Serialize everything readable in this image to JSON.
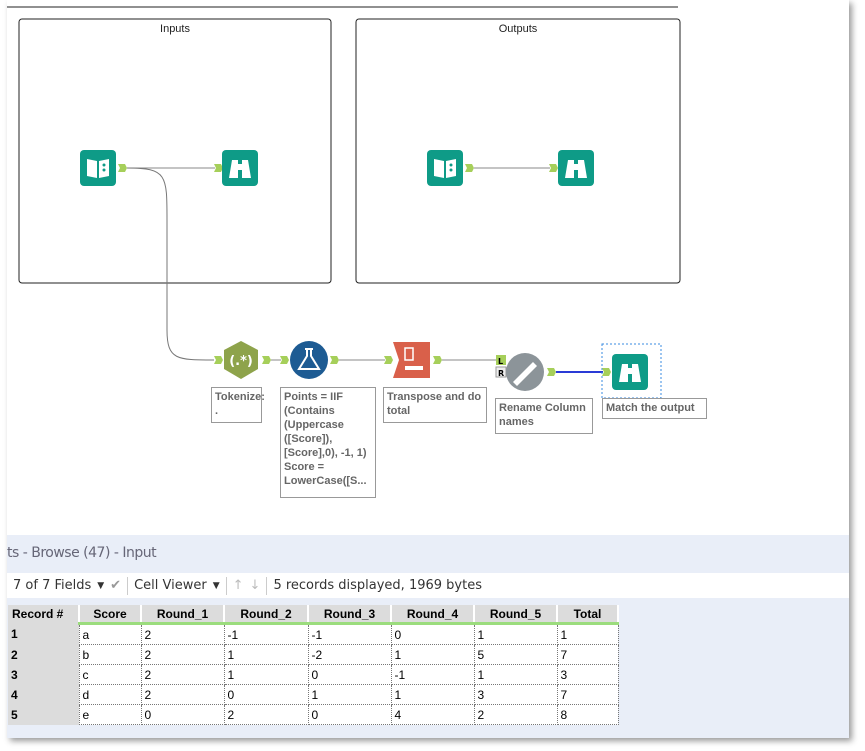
{
  "containers": [
    {
      "title": "Inputs"
    },
    {
      "title": "Outputs"
    }
  ],
  "tools": [
    {
      "name": "Tokenize",
      "annotation": "Tokenize:\n.",
      "color": "#8ea34b"
    },
    {
      "name": "Formula",
      "annotation": "Points = IIF (Contains (Uppercase ([Score]), [Score],0), -1, 1) Score = LowerCase([S...",
      "color": "#1d5b93"
    },
    {
      "name": "Transpose",
      "annotation": "Transpose and do total",
      "color": "#d9604a"
    },
    {
      "name": "Dynamic Rename",
      "annotation": "Rename Column names",
      "color": "#8c9499"
    },
    {
      "name": "Browse",
      "annotation": "Match the output",
      "color": "#0e9b87"
    }
  ],
  "results": {
    "title": "ts - Browse (47) - Input",
    "fields_label": "7 of 7 Fields",
    "viewer_label": "Cell Viewer",
    "status": "5 records displayed, 1969 bytes",
    "columns": [
      "Record #",
      "Score",
      "Round_1",
      "Round_2",
      "Round_3",
      "Round_4",
      "Round_5",
      "Total"
    ],
    "rows": [
      [
        "1",
        "a",
        "2",
        "-1",
        "-1",
        "0",
        "1",
        "1"
      ],
      [
        "2",
        "b",
        "2",
        "1",
        "-2",
        "1",
        "5",
        "7"
      ],
      [
        "3",
        "c",
        "2",
        "1",
        "0",
        "-1",
        "1",
        "3"
      ],
      [
        "4",
        "d",
        "2",
        "0",
        "1",
        "1",
        "3",
        "7"
      ],
      [
        "5",
        "e",
        "0",
        "2",
        "0",
        "4",
        "2",
        "8"
      ]
    ]
  }
}
